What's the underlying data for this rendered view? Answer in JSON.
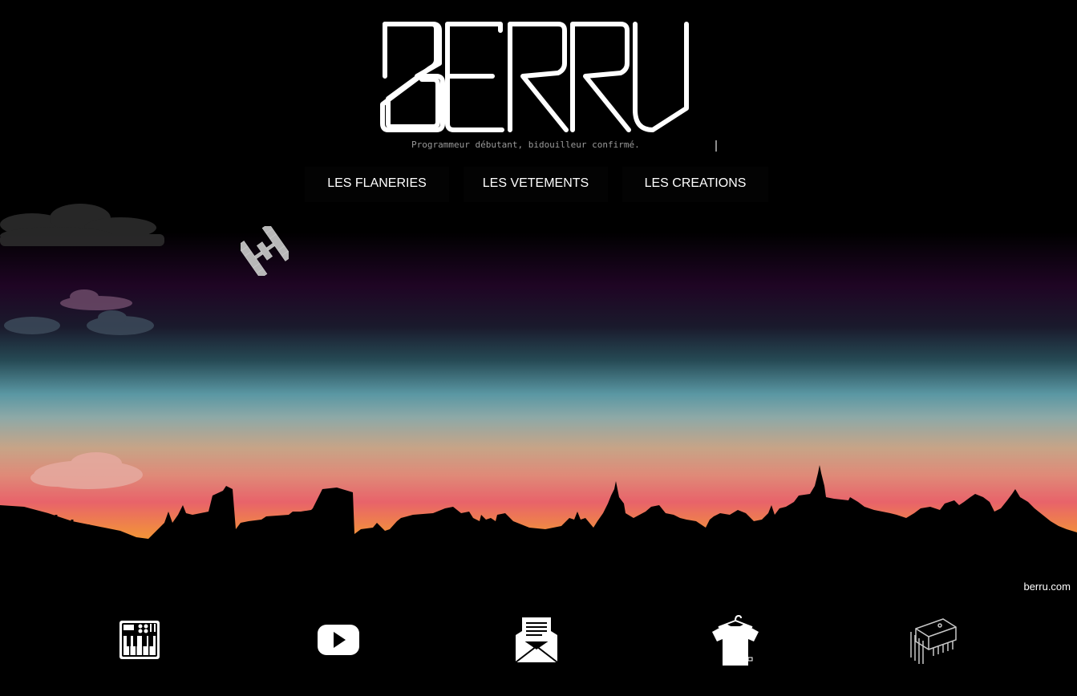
{
  "header": {
    "logo_text": "BERRU",
    "tagline": "Programmeur débutant, bidouilleur confirmé."
  },
  "nav": {
    "items": [
      {
        "label": "LES FLANERIES"
      },
      {
        "label": "LES VETEMENTS"
      },
      {
        "label": "LES CREATIONS"
      }
    ]
  },
  "footer": {
    "brand": "berru.com",
    "icons": [
      {
        "icon": "synthesizer-icon"
      },
      {
        "icon": "youtube-icon"
      },
      {
        "icon": "newsletter-envelope-icon"
      },
      {
        "icon": "tshirt-hanger-icon"
      },
      {
        "icon": "microchip-icon"
      }
    ]
  },
  "colors": {
    "background": "#000000",
    "text": "#ffffff",
    "tagline": "#9a9a9a",
    "sky_purple": "#1f0524",
    "sky_teal": "#5a97a3",
    "sky_pink": "#e8636a",
    "sky_orange": "#f7a823"
  }
}
